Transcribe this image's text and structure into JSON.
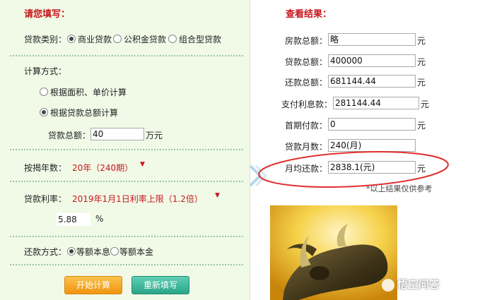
{
  "left": {
    "title": "请您填写：",
    "loan_type_label": "贷款类别：",
    "loan_types": [
      "商业贷款",
      "公积金贷款",
      "组合型贷款"
    ],
    "calc_method_label": "计算方式：",
    "calc_options": [
      "根据面积、单价计算",
      "根据贷款总额计算"
    ],
    "loan_total_label": "贷款总额：",
    "loan_total_value": "40",
    "loan_total_unit": "万元",
    "mortgage_years_label": "按揭年数：",
    "mortgage_years_value": "20年（240期）",
    "rate_label": "贷款利率：",
    "rate_value": "2019年1月1日利率上限（1.2倍）",
    "rate_number": "5.88",
    "rate_unit": "%",
    "repay_label": "还款方式：",
    "repay_options": [
      "等额本息",
      "等额本金"
    ],
    "start_button": "开始计算",
    "reset_button": "重新填写"
  },
  "right": {
    "title": "查看结果：",
    "rows": [
      {
        "label": "房款总额：",
        "value": "略",
        "unit": "元"
      },
      {
        "label": "贷款总额：",
        "value": "400000",
        "unit": "元"
      },
      {
        "label": "还款总额：",
        "value": "681144.44",
        "unit": "元"
      },
      {
        "label": "支付利息款：",
        "value": "281144.44",
        "unit": "元"
      },
      {
        "label": "首期付款：",
        "value": "0",
        "unit": "元"
      },
      {
        "label": "贷款月数：",
        "value": "240(月)",
        "unit": ""
      },
      {
        "label": "月均还款：",
        "value": "2838.1(元)",
        "unit": "元"
      }
    ],
    "note": "*以上结果仅供参考",
    "watermark": "悟空问答"
  },
  "colors": {
    "panel_bg": "#f1fae7",
    "accent_red": "#c8161d",
    "dots": "#9ac7a3",
    "start_btn": "#f5a623",
    "reset_btn": "#2fae8e",
    "circle": "#e03030"
  }
}
